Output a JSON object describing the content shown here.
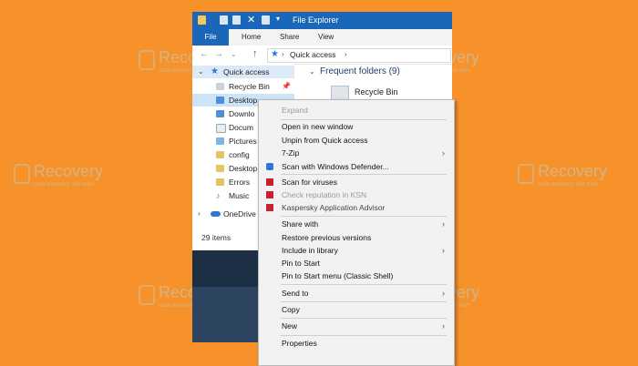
{
  "watermark": {
    "brand": "Recovery",
    "tagline": "Data Recovery Việt Nam"
  },
  "window": {
    "title": "File Explorer"
  },
  "ribbon": {
    "file_tab": "File",
    "tabs": [
      "Home",
      "Share",
      "View"
    ]
  },
  "address": {
    "path": "Quick access"
  },
  "nav": {
    "quick_access": "Quick access",
    "items": [
      "Recycle Bin",
      "Desktop",
      "Downlo",
      "Docum",
      "Pictures",
      "config",
      "Desktop",
      "Errors",
      "Music"
    ],
    "onedrive": "OneDrive"
  },
  "content": {
    "group_header": "Frequent folders (9)",
    "first_item": "Recycle Bin"
  },
  "status": {
    "count": "29 items"
  },
  "context_menu": {
    "expand": "Expand",
    "open_new_window": "Open in new window",
    "unpin": "Unpin from Quick access",
    "zip": "7-Zip",
    "scan_defender": "Scan with Windows Defender...",
    "scan_viruses": "Scan for viruses",
    "check_ksn": "Check reputation in KSN",
    "kaspersky_advisor": "Kaspersky Application Advisor",
    "share_with": "Share with",
    "restore": "Restore previous versions",
    "include_library": "Include in library",
    "pin_start": "Pin to Start",
    "pin_start_classic": "Pin to Start menu (Classic Shell)",
    "send_to": "Send to",
    "copy": "Copy",
    "new": "New",
    "properties": "Properties"
  },
  "colors": {
    "background": "#f7922a",
    "titlebar": "#1a66b8",
    "kaspersky": "#c8202f"
  }
}
